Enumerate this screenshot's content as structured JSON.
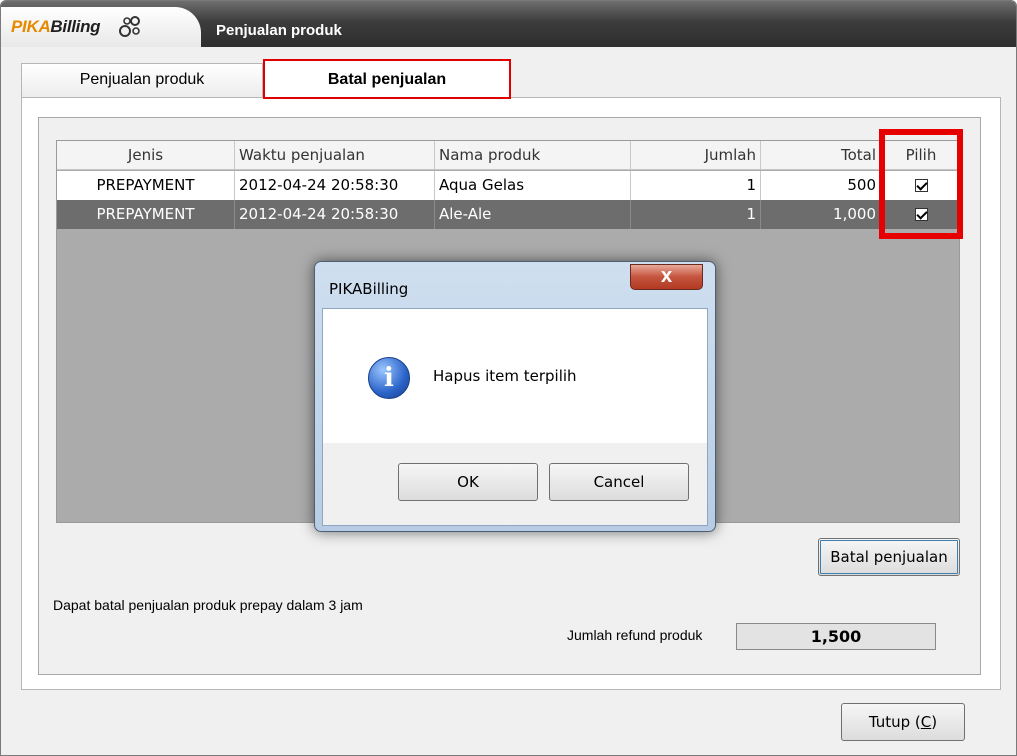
{
  "app": {
    "logo_pika": "PIKA",
    "logo_billing": "Billing",
    "window_title": "Penjualan produk"
  },
  "tabs": [
    {
      "label": "Penjualan produk",
      "active": false
    },
    {
      "label": "Batal penjualan",
      "active": true
    }
  ],
  "grid": {
    "columns": [
      "Jenis",
      "Waktu penjualan",
      "Nama produk",
      "Jumlah",
      "Total",
      "Pilih"
    ],
    "rows": [
      {
        "jenis": "PREPAYMENT",
        "waktu": "2012-04-24 20:58:30",
        "nama": "Aqua Gelas",
        "jumlah": "1",
        "total": "500",
        "pilih": true,
        "selected": false
      },
      {
        "jenis": "PREPAYMENT",
        "waktu": "2012-04-24 20:58:30",
        "nama": "Ale-Ale",
        "jumlah": "1",
        "total": "1,000",
        "pilih": true,
        "selected": true
      }
    ]
  },
  "actions": {
    "batal_label": "Batal penjualan",
    "tutup_label": "Tutup (",
    "tutup_mnemonic": "C",
    "tutup_suffix": ")"
  },
  "info": {
    "text": "Dapat batal penjualan produk prepay dalam 3 jam",
    "refund_label": "Jumlah refund produk",
    "refund_value": "1,500"
  },
  "dialog": {
    "title": "PIKABilling",
    "close_glyph": "X",
    "message": "Hapus item terpilih",
    "icon_glyph": "i",
    "ok_label": "OK",
    "cancel_label": "Cancel"
  },
  "colors": {
    "highlight": "#e60000",
    "selected_row": "#6d6d6d",
    "logo_accent": "#e68a00"
  }
}
